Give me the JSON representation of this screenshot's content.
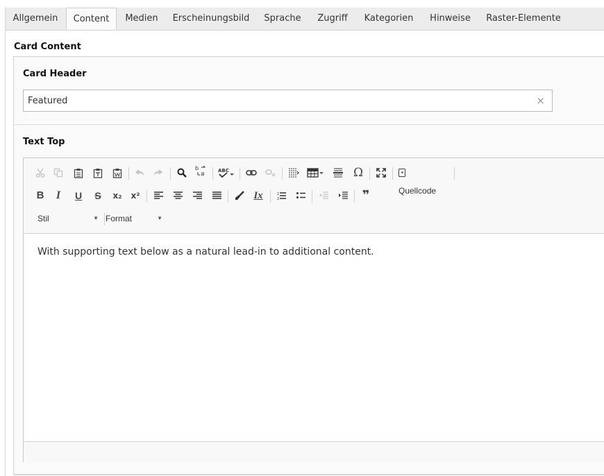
{
  "tabs": [
    {
      "label": "Allgemein"
    },
    {
      "label": "Content"
    },
    {
      "label": "Medien"
    },
    {
      "label": "Erscheinungsbild"
    },
    {
      "label": "Sprache"
    },
    {
      "label": "Zugriff"
    },
    {
      "label": "Kategorien"
    },
    {
      "label": "Hinweise"
    },
    {
      "label": "Raster-Elemente"
    }
  ],
  "active_tab": "Content",
  "card_content": {
    "title": "Card Content",
    "card_header": {
      "label": "Card Header",
      "value": "Featured",
      "clear_glyph": "×"
    },
    "text_top": {
      "label": "Text Top",
      "content": "With supporting text below as a natural lead-in to additional content."
    }
  },
  "editor_toolbar": {
    "row1": [
      "cut-icon",
      "copy-icon",
      "paste-icon",
      "paste-text-icon",
      "paste-word-icon",
      "undo-icon",
      "redo-icon",
      "find-icon",
      "replace-icon",
      "spellcheck-icon",
      "link-icon",
      "unlink-icon",
      "show-blocks-icon",
      "table-icon",
      "horizontal-rule-icon",
      "special-char-icon",
      "maximize-icon",
      "source-icon"
    ],
    "row2": [
      "bold-icon",
      "italic-icon",
      "underline-icon",
      "strike-icon",
      "subscript-icon",
      "superscript-icon",
      "align-left-icon",
      "align-center-icon",
      "align-right-icon",
      "align-justify-icon",
      "copy-format-icon",
      "remove-format-icon",
      "numbered-list-icon",
      "bulleted-list-icon",
      "outdent-icon",
      "indent-icon",
      "blockquote-icon"
    ],
    "source_label": "Quellcode",
    "style_combo": "Stil",
    "format_combo": "Format",
    "glyphs": {
      "bold": "B",
      "italic": "I",
      "underline": "U",
      "strike": "S",
      "subscript": "x₂",
      "superscript": "x²",
      "special_char": "Ω",
      "remove_format": "Ix",
      "blockquote": "❞",
      "spellcheck": "ABC",
      "replace": "b↔a"
    }
  }
}
